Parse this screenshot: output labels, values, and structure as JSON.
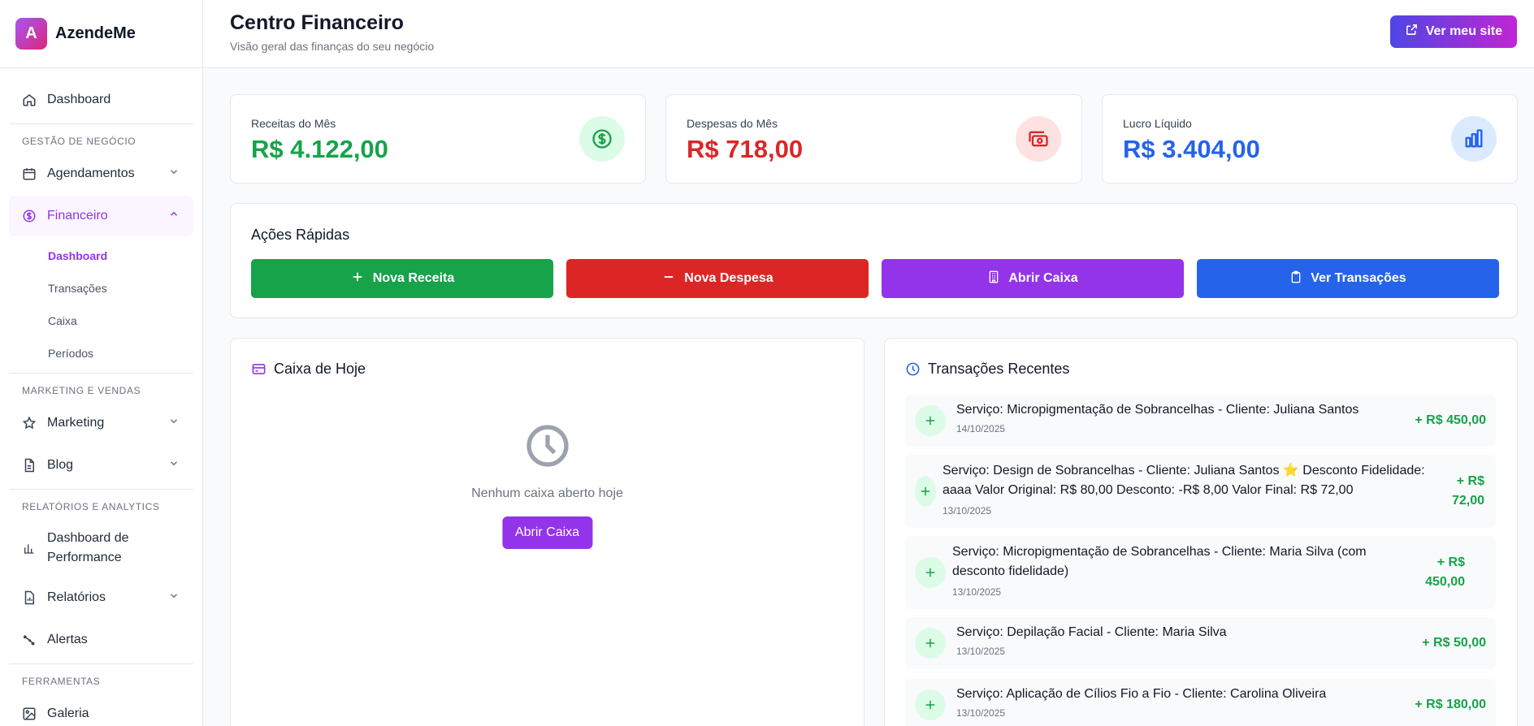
{
  "brand": {
    "logo_letter": "A",
    "name": "AzendeMe"
  },
  "sidebar": {
    "dashboard": "Dashboard",
    "section_business": "GESTÃO DE NEGÓCIO",
    "agendamentos": "Agendamentos",
    "financeiro": "Financeiro",
    "sub": [
      "Dashboard",
      "Transações",
      "Caixa",
      "Períodos"
    ],
    "section_marketing": "MARKETING E VENDAS",
    "marketing": "Marketing",
    "blog": "Blog",
    "section_reports": "RELATÓRIOS E ANALYTICS",
    "performance": "Dashboard de Performance",
    "relatorios": "Relatórios",
    "alertas": "Alertas",
    "section_tools": "FERRAMENTAS",
    "galeria": "Galeria"
  },
  "header": {
    "title": "Centro Financeiro",
    "subtitle": "Visão geral das finanças do seu negócio",
    "site_button": "Ver meu site"
  },
  "stats": [
    {
      "label": "Receitas do Mês",
      "value": "R$ 4.122,00",
      "color": "#16a34a",
      "icon": "dollar-circle-icon"
    },
    {
      "label": "Despesas do Mês",
      "value": "R$ 718,00",
      "color": "#dc2626",
      "icon": "money-icon"
    },
    {
      "label": "Lucro Líquido",
      "value": "R$ 3.404,00",
      "color": "#2563eb",
      "icon": "bar-chart-icon"
    }
  ],
  "quick_actions": {
    "title": "Ações Rápidas",
    "buttons": [
      "Nova Receita",
      "Nova Despesa",
      "Abrir Caixa",
      "Ver Transações"
    ]
  },
  "cash": {
    "title": "Caixa de Hoje",
    "empty_text": "Nenhum caixa aberto hoje",
    "open_button": "Abrir Caixa"
  },
  "transactions": {
    "title": "Transações Recentes",
    "items": [
      {
        "desc": "Serviço: Micropigmentação de Sobrancelhas - Cliente: Juliana Santos",
        "date": "14/10/2025",
        "amount": "+ R$ 450,00"
      },
      {
        "desc": "Serviço: Design de Sobrancelhas - Cliente: Juliana Santos ⭐ Desconto Fidelidade: aaaa Valor Original: R$ 80,00 Desconto: -R$ 8,00 Valor Final: R$ 72,00",
        "date": "13/10/2025",
        "amount": "+ R$ 72,00"
      },
      {
        "desc": "Serviço: Micropigmentação de Sobrancelhas - Cliente: Maria Silva (com desconto fidelidade)",
        "date": "13/10/2025",
        "amount": "+ R$ 450,00"
      },
      {
        "desc": "Serviço: Depilação Facial - Cliente: Maria Silva",
        "date": "13/10/2025",
        "amount": "+ R$ 50,00"
      },
      {
        "desc": "Serviço: Aplicação de Cílios Fio a Fio - Cliente: Carolina Oliveira",
        "date": "13/10/2025",
        "amount": "+ R$ 180,00"
      }
    ]
  },
  "colors": {
    "accent": "#9333ea",
    "green": "#16a34a",
    "red": "#dc2626",
    "blue": "#2563eb"
  }
}
